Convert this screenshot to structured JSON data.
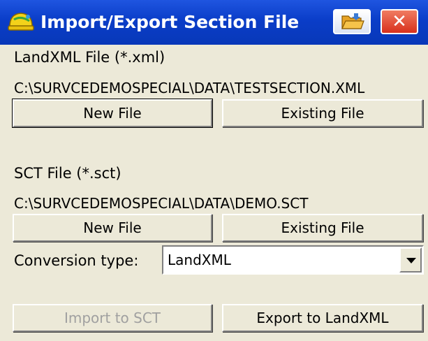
{
  "window": {
    "title": "Import/Export Section File",
    "app_icon": "hard-hat-icon",
    "open_icon": "open-folder-icon",
    "close_icon": "close-icon",
    "close_glyph": "✕"
  },
  "landxml": {
    "label": "LandXML File (*.xml)",
    "path": "C:\\SURVCEDEMOSPECIAL\\DATA\\TESTSECTION.XML",
    "new_button": "New File",
    "existing_button": "Existing File"
  },
  "sct": {
    "label": "SCT File (*.sct)",
    "path": "C:\\SURVCEDEMOSPECIAL\\DATA\\DEMO.SCT",
    "new_button": "New File",
    "existing_button": "Existing File"
  },
  "conversion": {
    "label": "Conversion type:",
    "selected": "LandXML"
  },
  "actions": {
    "import_label": "Import to SCT",
    "import_enabled": false,
    "export_label": "Export to LandXML"
  },
  "colors": {
    "titlebar": "#0a3dc8",
    "close_button": "#d8301c",
    "background": "#ece9d8"
  }
}
